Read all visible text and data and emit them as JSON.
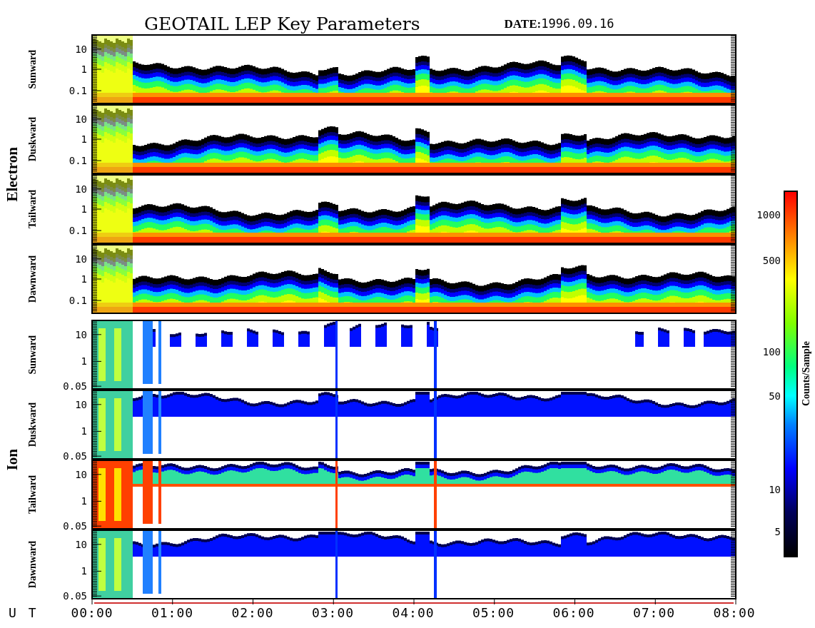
{
  "title": "GEOTAIL LEP Key Parameters",
  "date": {
    "label": "DATE:",
    "value": "1996.09.16"
  },
  "groups": [
    {
      "name": "Electron",
      "kind": "electron",
      "panels": [
        {
          "label": "Sunward",
          "yticks": [
            "10",
            "1",
            "0.1"
          ]
        },
        {
          "label": "Duskward",
          "yticks": [
            "10",
            "1",
            "0.1"
          ]
        },
        {
          "label": "Tailward",
          "yticks": [
            "10",
            "1",
            "0.1"
          ]
        },
        {
          "label": "Dawnward",
          "yticks": [
            "10",
            "1",
            "0.1"
          ]
        }
      ]
    },
    {
      "name": "Ion",
      "kind": "ion",
      "panels": [
        {
          "label": "Sunward",
          "yticks": [
            "10",
            "1",
            "0.05"
          ]
        },
        {
          "label": "Duskward",
          "yticks": [
            "10",
            "1",
            "0.05"
          ]
        },
        {
          "label": "Tailward",
          "yticks": [
            "10",
            "1",
            "0.05"
          ]
        },
        {
          "label": "Dawnward",
          "yticks": [
            "10",
            "1",
            "0.05"
          ]
        }
      ]
    }
  ],
  "colorbar": {
    "label": "Counts/Sample",
    "ticks": [
      "1000",
      "500",
      "100",
      "50",
      "10",
      "5"
    ]
  },
  "time_axis": {
    "label": "U T",
    "ticks": [
      "00:00",
      "01:00",
      "02:00",
      "03:00",
      "04:00",
      "05:00",
      "06:00",
      "07:00",
      "08:00"
    ]
  }
}
